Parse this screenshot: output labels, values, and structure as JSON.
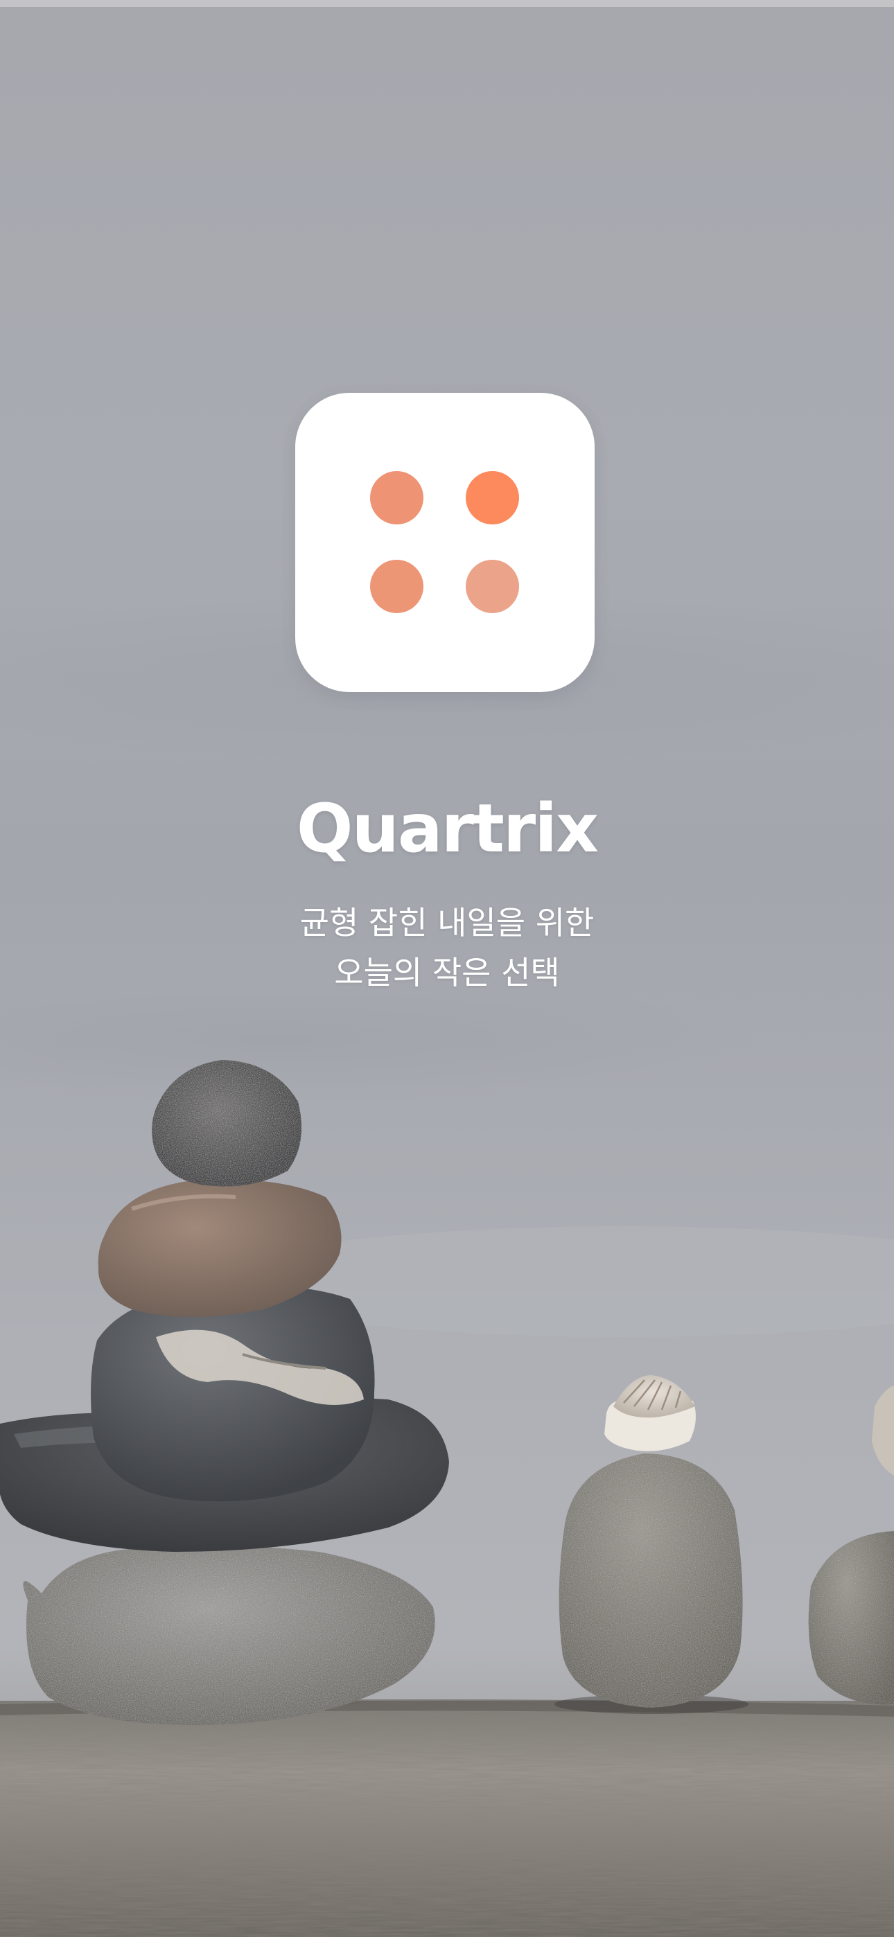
{
  "app": {
    "name": "Quartrix",
    "tagline_line1": "균형 잡힌 내일을 위한",
    "tagline_line2": "오늘의 작은 선택"
  },
  "logo": {
    "icon": "four-dots-logo-icon",
    "dot_colors": [
      "#ee9474",
      "#fd8a5c",
      "#ed9676",
      "#eba389"
    ],
    "background": "#ffffff"
  },
  "background_image": {
    "subject": "stacked-stone-cairns-on-driftwood-beach-photo"
  },
  "colors": {
    "text": "#ffffff",
    "sky": "#a9abb1"
  }
}
